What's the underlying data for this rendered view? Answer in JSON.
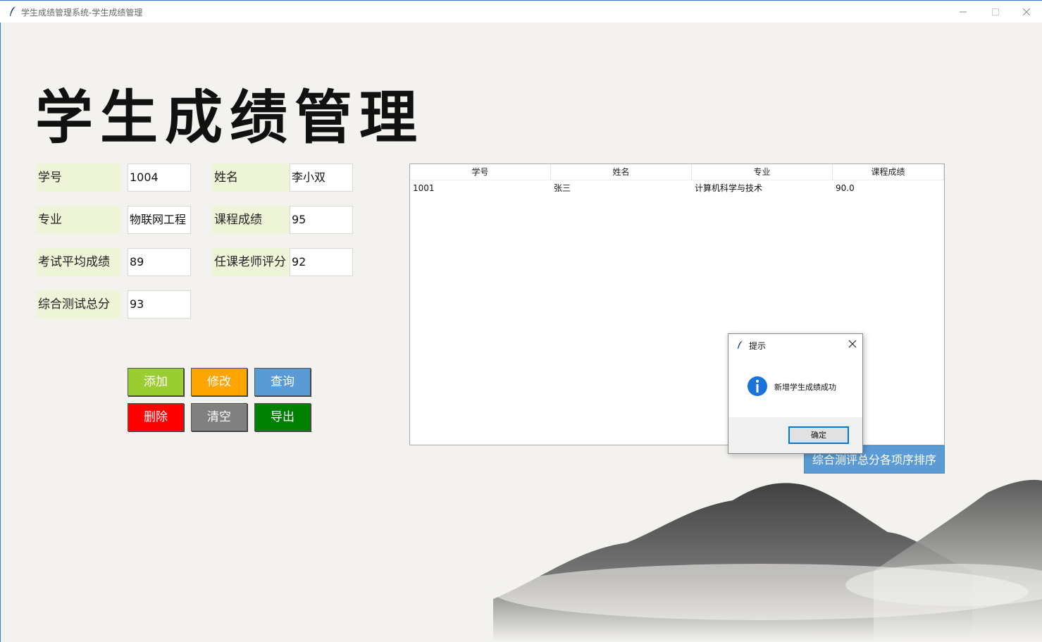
{
  "window": {
    "title": "学生成绩管理系统-学生成绩管理",
    "controls": [
      "minimize-icon",
      "maximize-icon",
      "close-icon"
    ]
  },
  "page_title": "学生成绩管理",
  "form": {
    "student_id": {
      "label": "学号",
      "value": "1004"
    },
    "name": {
      "label": "姓名",
      "value": "李小双"
    },
    "major": {
      "label": "专业",
      "value": "物联网工程"
    },
    "course_score": {
      "label": "课程成绩",
      "value": "95"
    },
    "exam_avg": {
      "label": "考试平均成绩",
      "value": "89"
    },
    "teacher_score": {
      "label": "任课老师评分",
      "value": "92"
    },
    "total_score": {
      "label": "综合测试总分",
      "value": "93"
    }
  },
  "buttons": {
    "add": {
      "label": "添加",
      "color": "#9acd32"
    },
    "edit": {
      "label": "修改",
      "color": "#ffa500"
    },
    "query": {
      "label": "查询",
      "color": "#5b9bd5"
    },
    "delete": {
      "label": "删除",
      "color": "#ff0000"
    },
    "clear": {
      "label": "清空",
      "color": "#808080"
    },
    "export": {
      "label": "导出",
      "color": "#008000"
    },
    "sort": {
      "label": "综合测评总分各项序排序",
      "color": "#5b9bd5"
    }
  },
  "table": {
    "columns": [
      "学号",
      "姓名",
      "专业",
      "课程成绩"
    ],
    "rows": [
      [
        "1001",
        "张三",
        "计算机科学与技术",
        "90.0"
      ]
    ]
  },
  "dialog": {
    "title": "提示",
    "message": "新增学生成绩成功",
    "ok_label": "确定",
    "icon": "info-icon"
  }
}
